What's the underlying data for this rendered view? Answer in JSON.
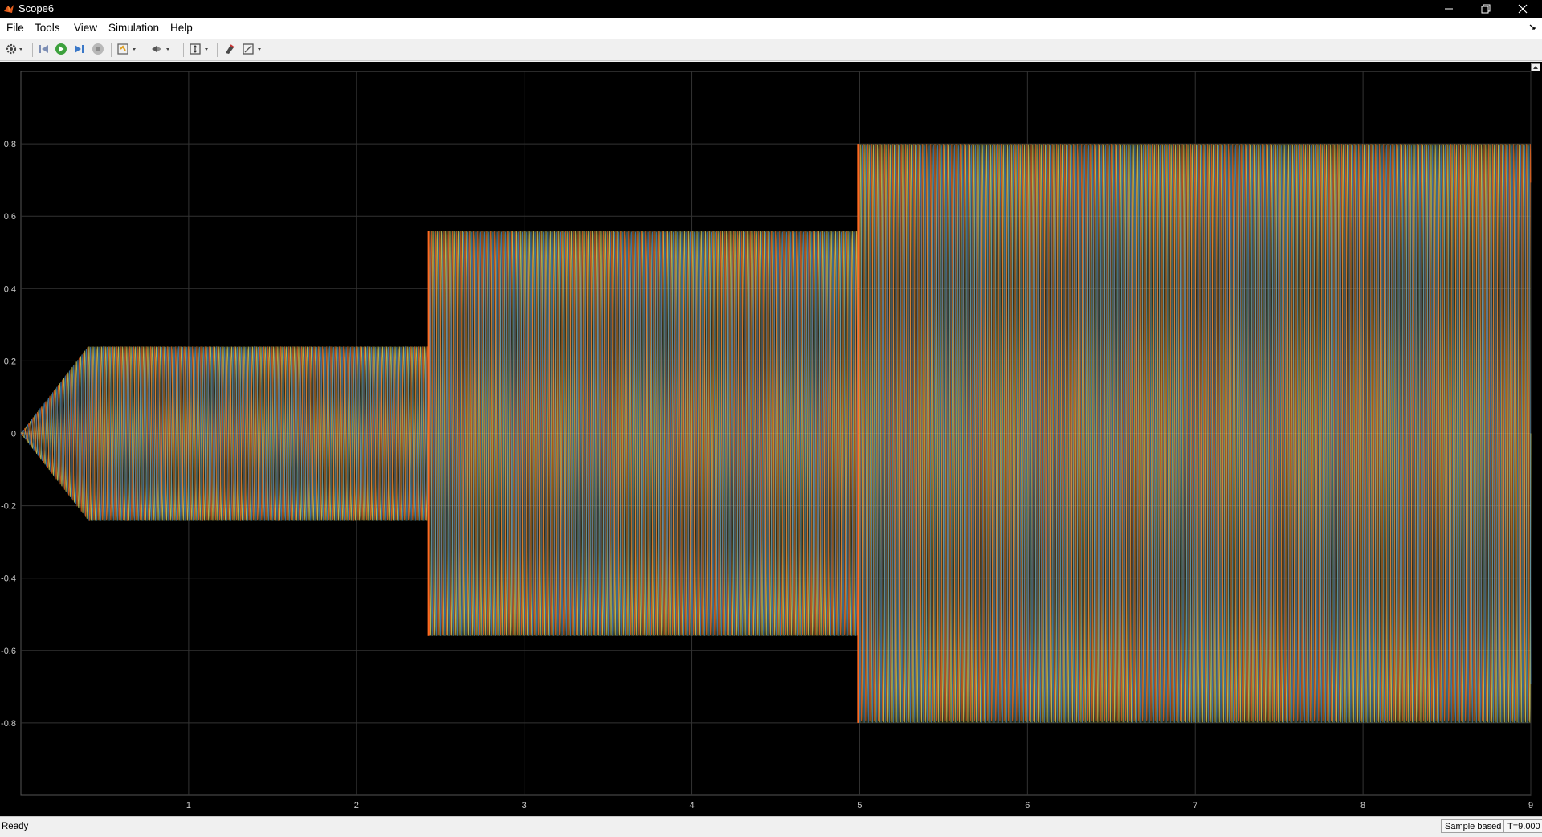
{
  "window": {
    "title": "Scope6",
    "icon": "matlab-icon",
    "controls": [
      "minimize-icon",
      "restore-icon",
      "close-icon"
    ]
  },
  "menu": [
    "File",
    "Tools",
    "View",
    "Simulation",
    "Help"
  ],
  "toolbar": {
    "icons": [
      "gear-icon",
      "step-back-icon",
      "run-icon",
      "step-forward-icon",
      "stop-icon",
      "highlight-icon",
      "zoom-icon",
      "scale-icon",
      "style-icon",
      "measurements-icon"
    ]
  },
  "status": {
    "left": "Ready",
    "mode": "Sample based",
    "time": "T=9.000"
  },
  "colors": {
    "background": "#000000",
    "grid": "#333333",
    "series_yellow": "#e8e060",
    "series_orange": "#ff6a20",
    "series_blue": "#3d8fd8"
  },
  "chart_data": {
    "type": "line",
    "title": "",
    "xlabel": "",
    "ylabel": "",
    "xlim": [
      0,
      9
    ],
    "ylim": [
      -1,
      1
    ],
    "x_ticks": [
      1,
      2,
      3,
      4,
      5,
      6,
      7,
      8,
      9
    ],
    "y_ticks": [
      0.8,
      0.6,
      0.4,
      0.2,
      0,
      -0.2,
      -0.4,
      -0.6,
      -0.8
    ],
    "y_tick_labels": [
      "0.8",
      "0.6",
      "0.4",
      "0.2",
      "0",
      "-0.2",
      "-0.4",
      "-0.6",
      "-0.8"
    ],
    "grid": true,
    "envelope": [
      {
        "t_start": 0.0,
        "t_end": 0.4,
        "amplitude_start": 0.0,
        "amplitude_end": 0.24
      },
      {
        "t_start": 0.4,
        "t_end": 2.43,
        "amplitude_start": 0.24,
        "amplitude_end": 0.24
      },
      {
        "t_start": 2.43,
        "t_end": 4.99,
        "amplitude_start": 0.56,
        "amplitude_end": 0.56
      },
      {
        "t_start": 4.99,
        "t_end": 9.0,
        "amplitude_start": 0.8,
        "amplitude_end": 0.8
      }
    ],
    "series": [
      {
        "color": "#e8e060",
        "phase_deg": 0
      },
      {
        "color": "#ff6a20",
        "phase_deg": 120
      },
      {
        "color": "#3d8fd8",
        "phase_deg": 240
      }
    ]
  }
}
